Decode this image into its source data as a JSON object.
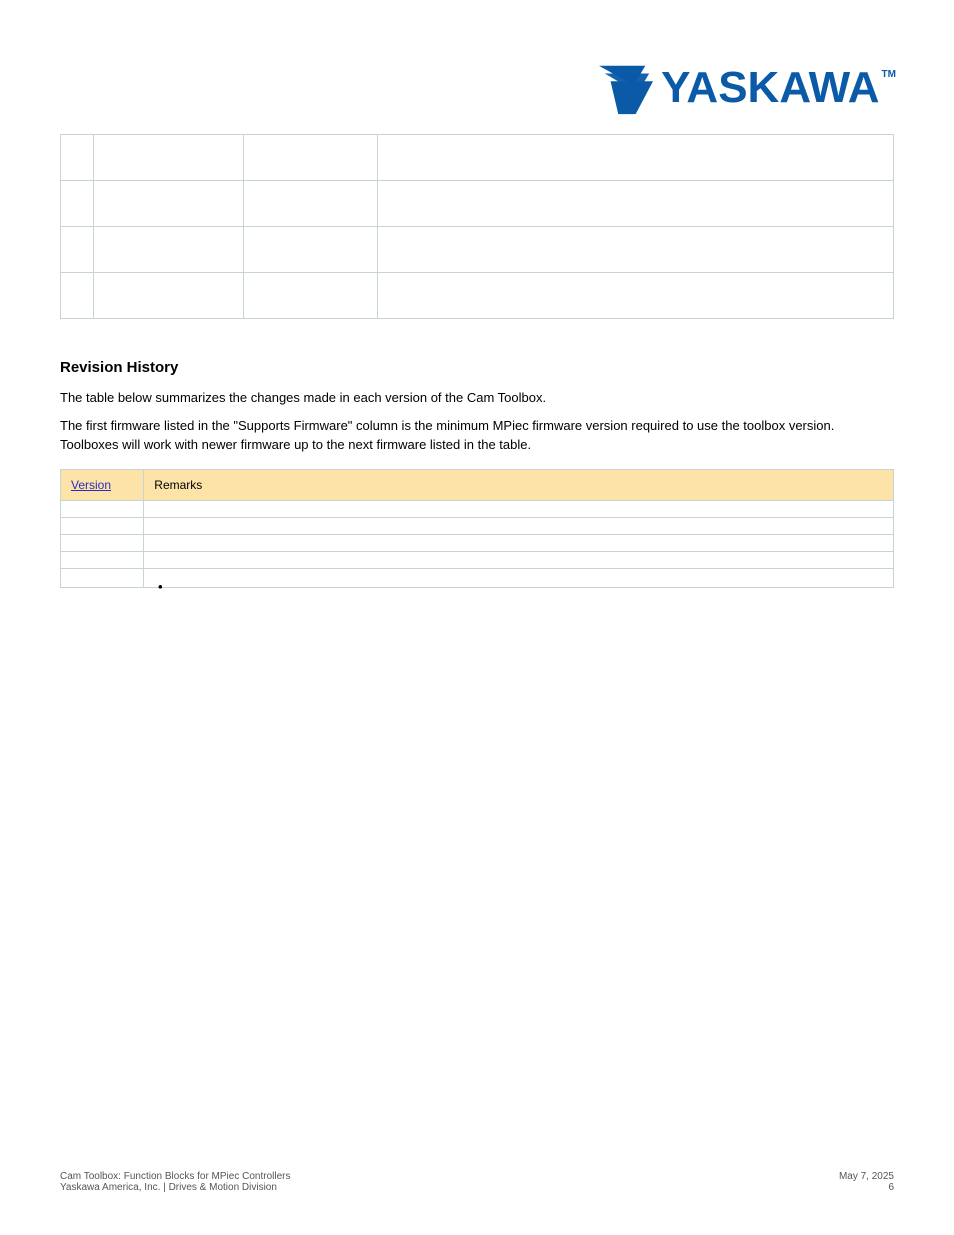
{
  "logo_text": "YASKAWA",
  "logo_tm": "TM",
  "features_rows": [
    {
      "c1": "",
      "c2": "",
      "c3": "",
      "c4": ""
    },
    {
      "c1": "",
      "c2": "",
      "c3": "",
      "c4": ""
    },
    {
      "c1": "",
      "c2": "",
      "c3": "",
      "c4": ""
    },
    {
      "c1": "",
      "c2": "",
      "c3": "",
      "c4": ""
    }
  ],
  "history_heading": "Revision History",
  "history_p1": "The table below summarizes the changes made in each version of the Cam Toolbox.",
  "history_p2": "The first firmware listed in the \"Supports Firmware\" column is the minimum MPiec firmware version required to use the toolbox version. Toolboxes will work with newer firmware up to the next firmware listed in the table.",
  "history_header_version": "Version",
  "history_header_remarks": "Remarks",
  "history_rows": [
    {
      "ver": "",
      "rem_text": ""
    },
    {
      "ver": "",
      "rem_text": ""
    },
    {
      "ver": "",
      "rem_text": ""
    },
    {
      "ver": "",
      "rem_text": ""
    }
  ],
  "history_row5_ver": "",
  "history_bullets": [
    "",
    "",
    "",
    "",
    "",
    "",
    "",
    "",
    "",
    ""
  ],
  "footer_left": "Cam Toolbox: Function Blocks for MPiec Controllers\nYaskawa America, Inc. | Drives & Motion Division",
  "footer_right": "May 7, 2025\n6"
}
